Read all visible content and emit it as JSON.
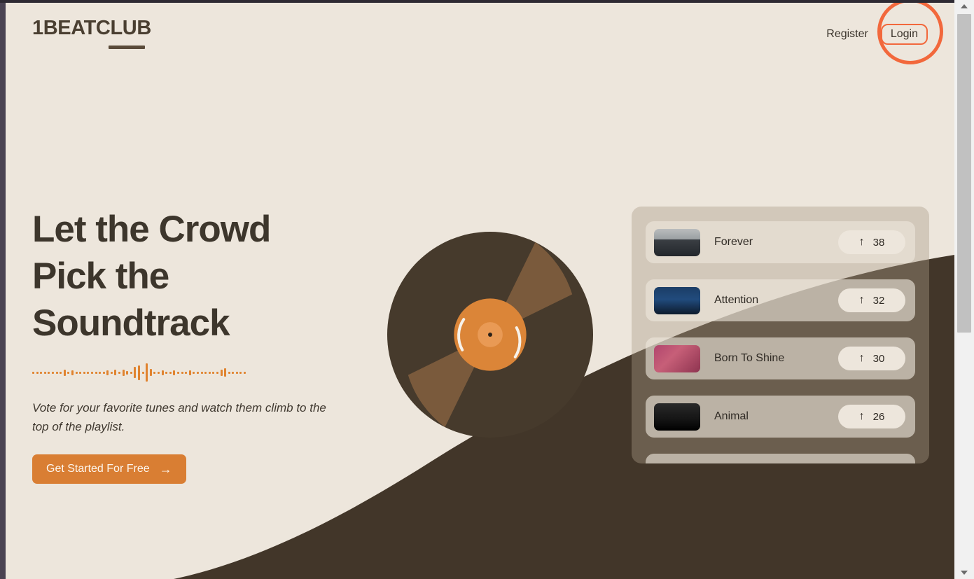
{
  "brand": {
    "name": "1BEATCLUB"
  },
  "nav": {
    "register_label": "Register",
    "login_label": "Login"
  },
  "hero": {
    "heading_line1": "Let the Crowd",
    "heading_line2": "Pick the",
    "heading_line3": "Soundtrack",
    "subtitle": "Vote for your favorite tunes and watch them climb to the top of the playlist.",
    "cta_label": "Get Started For Free",
    "cta_arrow": "→"
  },
  "playlist": {
    "tracks": [
      {
        "title": "Forever",
        "votes": "38",
        "arrow": "↑"
      },
      {
        "title": "Attention",
        "votes": "32",
        "arrow": "↑"
      },
      {
        "title": "Born To Shine",
        "votes": "30",
        "arrow": "↑"
      },
      {
        "title": "Animal",
        "votes": "26",
        "arrow": "↑"
      }
    ]
  },
  "colors": {
    "background": "#EDE6DC",
    "dark_brown": "#423629",
    "accent_orange": "#D97E33",
    "annotation_orange": "#F2683C",
    "vinyl_dark": "#463A2C",
    "vinyl_wedge": "#7A5A3C",
    "panel": "#CFC8BC"
  },
  "chrome": {
    "scroll_up": "▲",
    "scroll_down": "▼"
  }
}
